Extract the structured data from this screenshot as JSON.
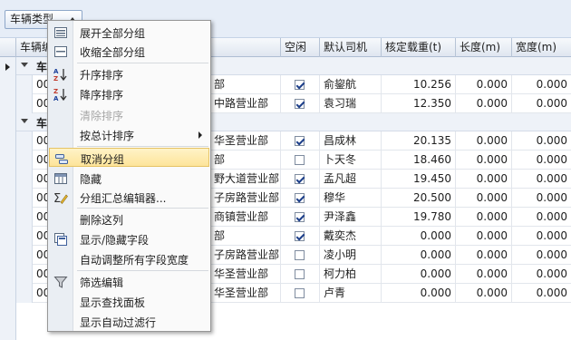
{
  "group_panel": {
    "chip_label": "车辆类型"
  },
  "grid": {
    "columns": [
      "车辆编号",
      "空闲",
      "默认司机",
      "核定载重(t)",
      "长度(m)",
      "宽度(m)"
    ],
    "groups": [
      {
        "label": "车"
      },
      {
        "label": "车"
      }
    ],
    "rows": [
      {
        "id": "00",
        "dept": "部",
        "idle": true,
        "driver": "俞鋆航",
        "load": "10.256",
        "length": "0.000",
        "width": "0.000"
      },
      {
        "id": "00",
        "dept": "中路营业部",
        "idle": true,
        "driver": "袁习瑞",
        "load": "12.350",
        "length": "0.000",
        "width": "0.000"
      },
      {
        "id": "00",
        "dept": "华圣营业部",
        "idle": true,
        "driver": "昌成林",
        "load": "20.135",
        "length": "0.000",
        "width": "0.000"
      },
      {
        "id": "00",
        "dept": "部",
        "idle": false,
        "driver": "卜天冬",
        "load": "18.460",
        "length": "0.000",
        "width": "0.000"
      },
      {
        "id": "00",
        "dept": "野大道营业部",
        "idle": true,
        "driver": "孟凡超",
        "load": "19.450",
        "length": "0.000",
        "width": "0.000"
      },
      {
        "id": "00",
        "dept": "子房路营业部",
        "idle": true,
        "driver": "穆华",
        "load": "20.500",
        "length": "0.000",
        "width": "0.000"
      },
      {
        "id": "00",
        "dept": "商镇营业部",
        "idle": true,
        "driver": "尹泽鑫",
        "load": "19.780",
        "length": "0.000",
        "width": "0.000"
      },
      {
        "id": "00",
        "dept": "部",
        "idle": true,
        "driver": "戴奕杰",
        "load": "0.000",
        "length": "0.000",
        "width": "0.000"
      },
      {
        "id": "00",
        "dept": "子房路营业部",
        "idle": false,
        "driver": "凌小明",
        "load": "0.000",
        "length": "0.000",
        "width": "0.000"
      },
      {
        "id": "00",
        "dept": "华圣营业部",
        "idle": false,
        "driver": "柯力柏",
        "load": "0.000",
        "length": "0.000",
        "width": "0.000"
      },
      {
        "id": "00",
        "dept": "华圣营业部",
        "idle": false,
        "driver": "卢青",
        "load": "0.000",
        "length": "0.000",
        "width": "0.000"
      }
    ]
  },
  "context_menu": {
    "items": [
      {
        "label": "展开全部分组",
        "icon": "expand-groups-icon"
      },
      {
        "label": "收缩全部分组",
        "icon": "collapse-groups-icon"
      },
      {
        "label": "升序排序",
        "icon": "sort-ascending-icon"
      },
      {
        "label": "降序排序",
        "icon": "sort-descending-icon"
      },
      {
        "label": "清除排序",
        "icon": "",
        "disabled": true
      },
      {
        "label": "按总计排序",
        "icon": "",
        "submenu": true
      },
      {
        "label": "取消分组",
        "icon": "ungroup-icon",
        "highlighted": true
      },
      {
        "label": "隐藏",
        "icon": "hide-column-icon"
      },
      {
        "label": "分组汇总编辑器...",
        "icon": "group-summary-editor-icon"
      },
      {
        "label": "删除这列",
        "icon": ""
      },
      {
        "label": "显示/隐藏字段",
        "icon": "column-chooser-icon"
      },
      {
        "label": "自动调整所有字段宽度",
        "icon": ""
      },
      {
        "label": "筛选编辑",
        "icon": "filter-icon"
      },
      {
        "label": "显示查找面板",
        "icon": ""
      },
      {
        "label": "显示自动过滤行",
        "icon": ""
      }
    ]
  },
  "colors": {
    "accent": "#fde49a",
    "header": "#dfe6f0",
    "group_bg": "#eef2f8"
  }
}
